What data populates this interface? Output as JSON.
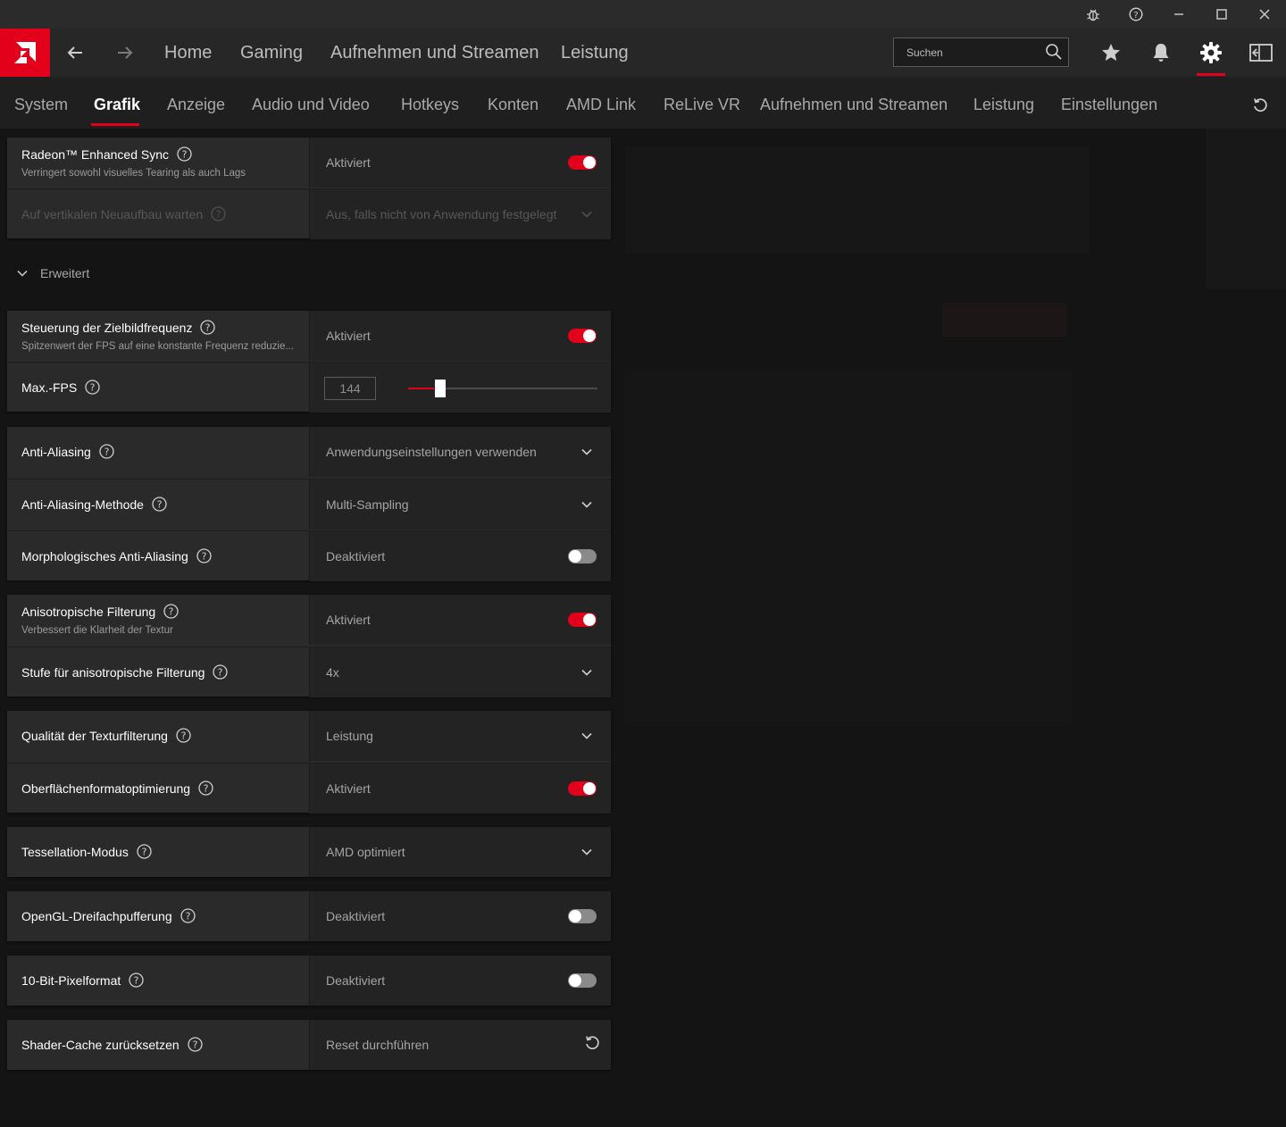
{
  "window": {
    "controls": {
      "bug_icon": "bug-icon",
      "help_icon": "help-icon",
      "minimize": "minimize-icon",
      "maximize": "maximize-icon",
      "close": "close-icon"
    }
  },
  "topnav": {
    "links": [
      "Home",
      "Gaming",
      "Aufnehmen und Streamen",
      "Leistung"
    ],
    "search_placeholder": "Suchen",
    "icons": [
      "star-icon",
      "bell-icon",
      "gear-icon",
      "sidebar-toggle-icon"
    ],
    "accent": "#e2001a"
  },
  "subnav": {
    "tabs": [
      "System",
      "Grafik",
      "Anzeige",
      "Audio und Video",
      "Hotkeys",
      "Konten",
      "AMD Link",
      "ReLive VR",
      "Aufnehmen und Streamen",
      "Leistung",
      "Einstellungen"
    ],
    "active": "Grafik"
  },
  "settings": {
    "enhanced_sync": {
      "title": "Radeon™ Enhanced Sync",
      "desc": "Verringert sowohl visuelles Tearing als auch Lags",
      "value": "Aktiviert",
      "enabled": true
    },
    "vsync": {
      "title": "Auf vertikalen Neuaufbau warten",
      "value": "Aus, falls nicht von Anwendung festgelegt"
    },
    "section_label": "Erweitert",
    "frtc": {
      "title": "Steuerung der Zielbildfrequenz",
      "desc": "Spitzenwert der FPS auf eine konstante Frequenz reduzie...",
      "value": "Aktiviert",
      "enabled": true
    },
    "max_fps": {
      "title": "Max.-FPS",
      "value": "144",
      "slider_fraction": 0.15
    },
    "anti_aliasing": {
      "title": "Anti-Aliasing",
      "value": "Anwendungseinstellungen verwenden"
    },
    "aa_method": {
      "title": "Anti-Aliasing-Methode",
      "value": "Multi-Sampling"
    },
    "mlaa": {
      "title": "Morphologisches Anti-Aliasing",
      "value": "Deaktiviert",
      "enabled": false
    },
    "aniso": {
      "title": "Anisotropische Filterung",
      "desc": "Verbessert die Klarheit der Textur",
      "value": "Aktiviert",
      "enabled": true
    },
    "aniso_level": {
      "title": "Stufe für anisotropische Filterung",
      "value": "4x"
    },
    "tex_quality": {
      "title": "Qualität der Texturfilterung",
      "value": "Leistung"
    },
    "surface_opt": {
      "title": "Oberflächenformatoptimierung",
      "value": "Aktiviert",
      "enabled": true
    },
    "tessellation": {
      "title": "Tessellation-Modus",
      "value": "AMD optimiert"
    },
    "opengl_triple": {
      "title": "OpenGL-Dreifachpufferung",
      "value": "Deaktiviert",
      "enabled": false
    },
    "ten_bit": {
      "title": "10-Bit-Pixelformat",
      "value": "Deaktiviert",
      "enabled": false
    },
    "shader_cache": {
      "title": "Shader-Cache zurücksetzen",
      "value": "Reset durchführen"
    }
  }
}
